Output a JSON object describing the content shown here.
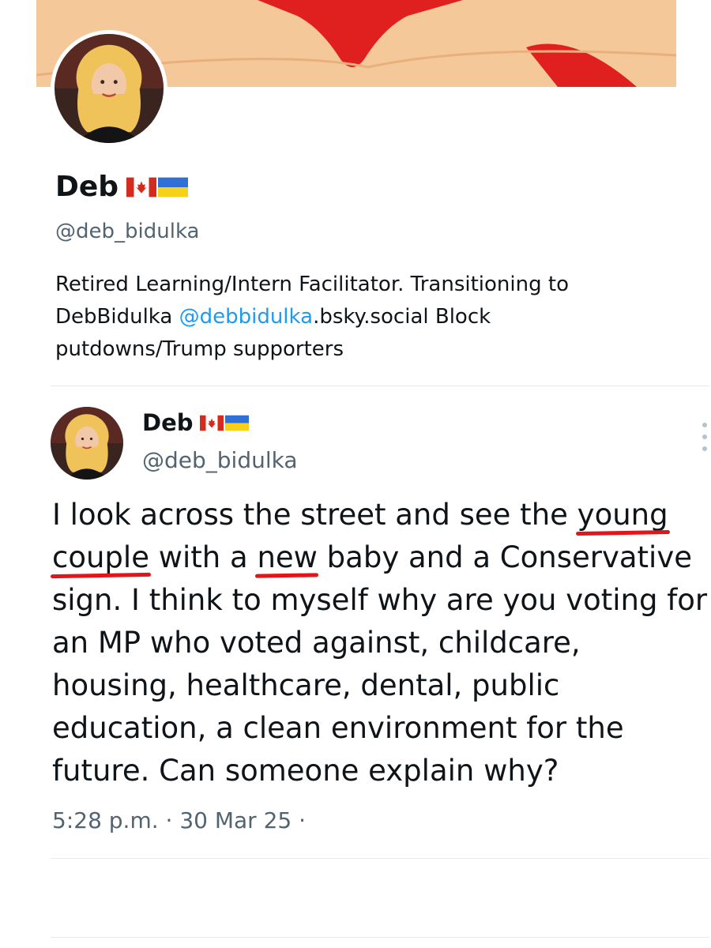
{
  "profile": {
    "display_name": "Deb",
    "handle": "@deb_bidulka",
    "bio": {
      "before_mention": "Retired Learning/Intern Facilitator. Transitioning to DebBidulka ",
      "mention": "@debbidulka",
      "after_mention": ".bsky.social Block putdowns/Trump supporters"
    },
    "flags": [
      "canada-flag-icon",
      "ukraine-flag-icon"
    ]
  },
  "tweet": {
    "display_name": "Deb",
    "handle": "@deb_bidulka",
    "text": {
      "p1": "I look across the street and see the ",
      "u1": "young",
      "p2": " ",
      "u2": "couple",
      "p3": " with a ",
      "u3": "new",
      "p4": " baby and a Conservative sign. I think to myself why are you voting for an MP who voted against, childcare, housing, healthcare, dental, public education, a clean environment for the future. Can someone explain why?"
    },
    "timestamp": "5:28 p.m. · 30 Mar 25 ·"
  },
  "colors": {
    "link": "#1d9bf0",
    "secondary_text": "#536471",
    "underline_annotation": "#e0161b",
    "banner_bg": "#f5c89a",
    "banner_red": "#e0201e"
  }
}
